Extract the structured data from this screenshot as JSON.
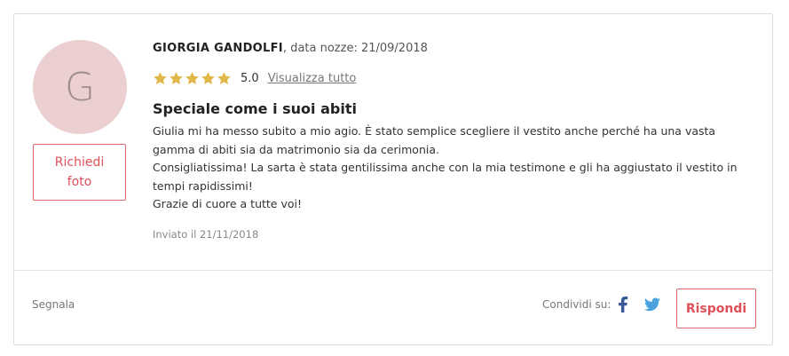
{
  "review": {
    "avatar_initial": "G",
    "request_photo_label": "Richiedi foto",
    "author": "GIORGIA GANDOLFI",
    "wedding_date": ", data nozze: 21/09/2018",
    "rating_stars": 5,
    "score": "5.0",
    "view_all": "Visualizza tutto",
    "title": "Speciale come i suoi abiti",
    "body": [
      "Giulia mi ha messo subito a mio agio. È stato semplice scegliere il vestito anche perché ha una vasta gamma di abiti sia da matrimonio sia da cerimonia.",
      "Consigliatissima! La sarta è stata gentilissima anche con la mia testimone e gli ha aggiustato il vestito in tempi rapidissimi!",
      "Grazie di cuore a tutte voi!"
    ],
    "sent_date": "Inviato il 21/11/2018"
  },
  "footer": {
    "report": "Segnala",
    "share_label": "Condividi su:",
    "share_icons": [
      "facebook-icon",
      "twitter-icon"
    ],
    "reply": "Rispondi"
  },
  "colors": {
    "accent": "#e0505a",
    "star": "#e0b84a",
    "avatar_bg": "#ebcfd1",
    "facebook": "#3b5998",
    "twitter": "#4aa3df"
  }
}
